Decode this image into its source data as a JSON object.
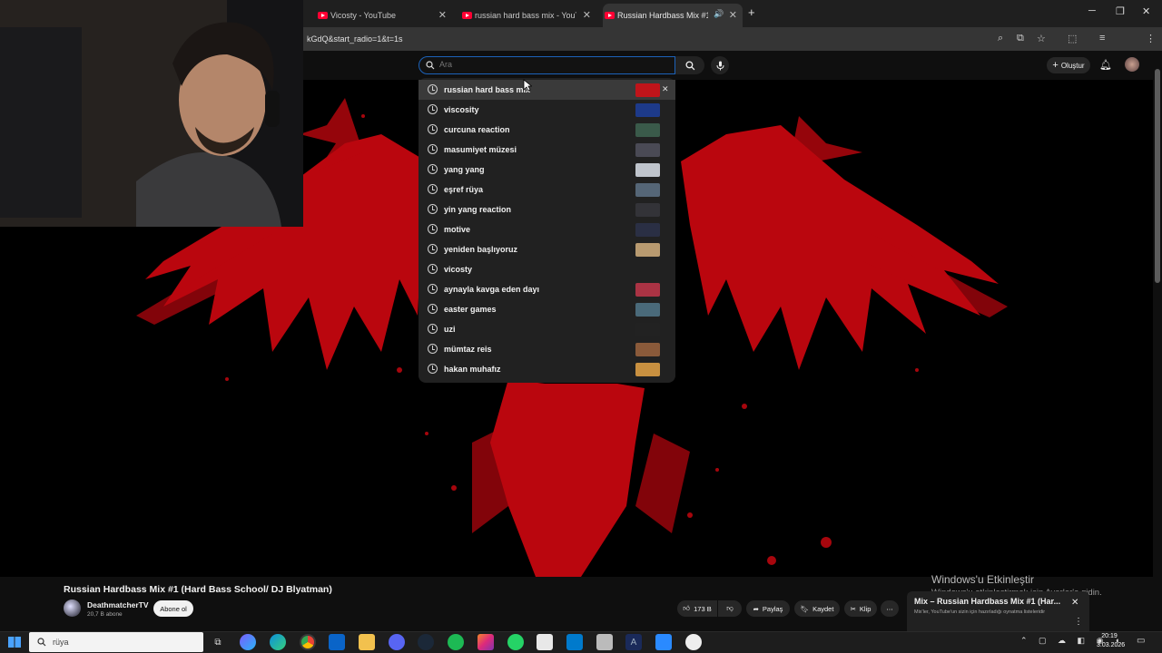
{
  "browser": {
    "tabs": [
      {
        "title": "Vicosty - YouTube",
        "active": false
      },
      {
        "title": "russian hard bass mix - YouTube",
        "active": false
      },
      {
        "title": "Russian Hardbass Mix #1 (H",
        "active": true
      }
    ],
    "url": "kGdQ&start_radio=1&t=1s",
    "new_tab": "+",
    "close_glyph": "✕"
  },
  "youtube": {
    "search": {
      "placeholder": "Ara",
      "value": ""
    },
    "create_label": "Oluştur",
    "suggestions": [
      {
        "text": "russian hard bass mix",
        "thumb": "#c0141a",
        "highlighted": true,
        "remove": "✕"
      },
      {
        "text": "viscosity",
        "thumb": "#1d3a8a"
      },
      {
        "text": "curcuna reaction",
        "thumb": "#3a5a4a"
      },
      {
        "text": "masumiyet müzesi",
        "thumb": "#4a4a55"
      },
      {
        "text": "yang yang",
        "thumb": "#bfc4cc"
      },
      {
        "text": "eşref rüya",
        "thumb": "#556677"
      },
      {
        "text": "yin yang reaction",
        "thumb": "#333338"
      },
      {
        "text": "motive",
        "thumb": "#2a2f44"
      },
      {
        "text": "yeniden başlıyoruz",
        "thumb": "#b89a70"
      },
      {
        "text": "vicosty",
        "thumb": ""
      },
      {
        "text": "aynayla kavga eden dayı",
        "thumb": "#aa3344"
      },
      {
        "text": "easter games",
        "thumb": "#4a6a7a"
      },
      {
        "text": "uzi",
        "thumb": "#222222"
      },
      {
        "text": "mümtaz reis",
        "thumb": "#8a5a3a"
      },
      {
        "text": "hakan muhafız",
        "thumb": "#c89040"
      }
    ],
    "video": {
      "title": "Russian Hardbass Mix #1 (Hard Bass School/ DJ Blyatman)",
      "channel": "DeathmatcherTV",
      "subscribers": "20,7 B abone",
      "subscribe_label": "Abone ol",
      "likes": "173 B",
      "share_label": "Paylaş",
      "save_label": "Kaydet",
      "clip_label": "Klip",
      "more": "⋯"
    },
    "miniplayer": {
      "title": "Mix – Russian Hardbass Mix #1 (Har...",
      "subtitle": "Mix'ler, YouTube'un sizin için hazırladığı oynatma listeleridir"
    }
  },
  "windows": {
    "activate_title": "Windows'u Etkinleştir",
    "activate_sub": "Windows'u etkinleştirmek için Ayarlar'a gidin.",
    "taskbar_search": "rüya",
    "time": "20:19",
    "date": "3.03.2026",
    "tray": "⌃ ▢ ☁ ◧ ◉ ◖"
  },
  "colors": {
    "accent_blue": "#1c62b9",
    "yt_red": "#ff0033",
    "splash_red": "#c4070f"
  }
}
